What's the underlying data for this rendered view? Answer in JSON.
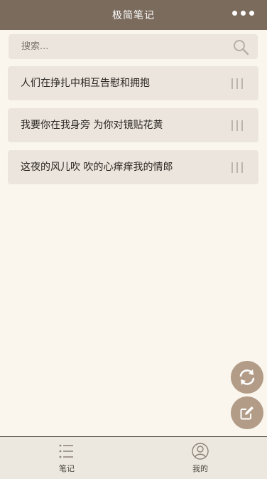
{
  "navbar": {
    "title": "极简笔记",
    "more_icon": "more-horizontal-icon"
  },
  "search": {
    "placeholder": "搜索...",
    "value": "",
    "icon": "search-icon"
  },
  "notes": [
    {
      "title": "人们在挣扎中相互告慰和拥抱"
    },
    {
      "title": "我要你在我身旁 为你对镜贴花黄"
    },
    {
      "title": "这夜的风儿吹 吹的心痒痒我的情郎"
    }
  ],
  "fabs": {
    "sync_icon": "sync-icon",
    "edit_icon": "edit-icon"
  },
  "tabbar": {
    "tabs": [
      {
        "label": "笔记",
        "icon": "list-icon"
      },
      {
        "label": "我的",
        "icon": "user-icon"
      }
    ]
  },
  "colors": {
    "navbar": "#7a6b5d",
    "background": "#faf6ee",
    "card": "#ece5dd",
    "fab": "#b29c87",
    "tabbar": "#ede8df"
  }
}
